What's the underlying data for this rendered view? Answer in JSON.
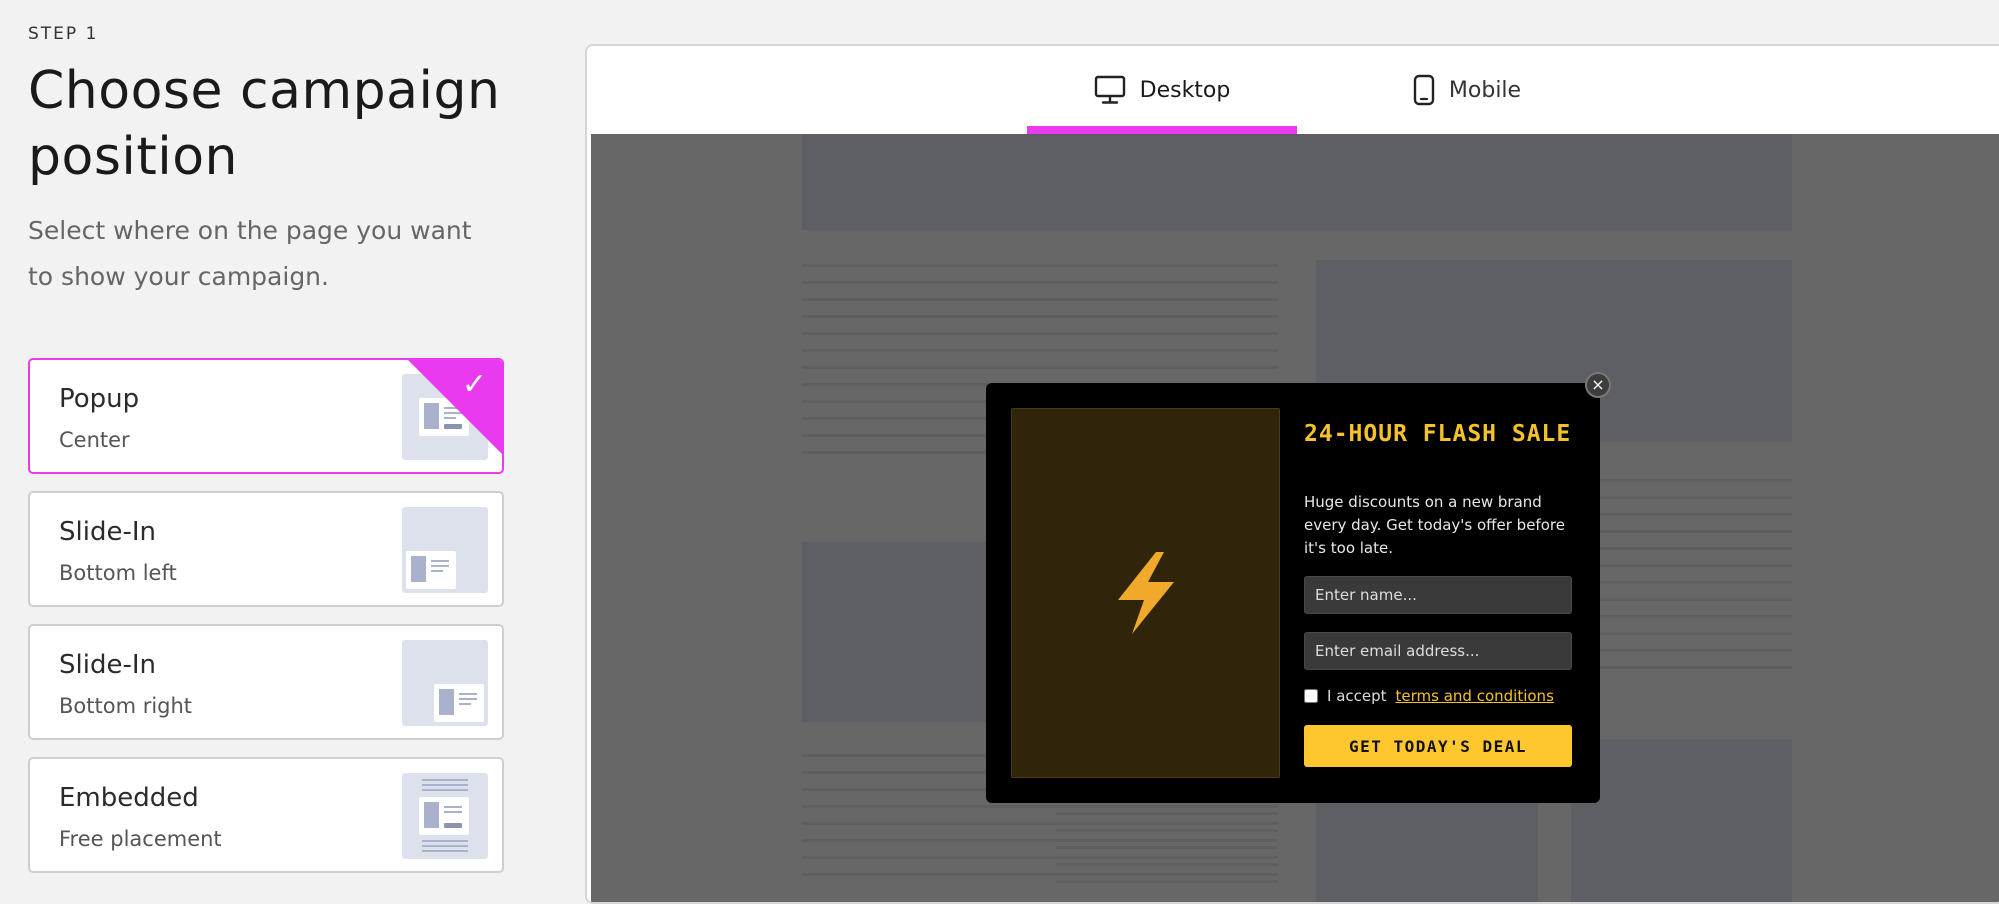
{
  "header": {
    "step": "STEP 1",
    "title": "Choose campaign position",
    "subtitle": "Select where on the page you want to show your campaign."
  },
  "positions": [
    {
      "name": "Popup",
      "sub": "Center",
      "selected": true,
      "icon": "popup-center-thumb"
    },
    {
      "name": "Slide-In",
      "sub": "Bottom left",
      "selected": false,
      "icon": "slidein-bottom-left-thumb"
    },
    {
      "name": "Slide-In",
      "sub": "Bottom right",
      "selected": false,
      "icon": "slidein-bottom-right-thumb"
    },
    {
      "name": "Embedded",
      "sub": "Free placement",
      "selected": false,
      "icon": "embedded-thumb"
    }
  ],
  "preview": {
    "tabs": [
      {
        "label": "Desktop",
        "icon": "desktop-monitor-icon",
        "active": true
      },
      {
        "label": "Mobile",
        "icon": "mobile-phone-icon",
        "active": false
      }
    ]
  },
  "popup": {
    "title": "24-HOUR FLASH SALE",
    "description": "Huge discounts on a new brand every day. Get today's offer before it's too late.",
    "name_placeholder": "Enter name...",
    "email_placeholder": "Enter email address...",
    "accept_text": "I accept",
    "terms_text": "terms and conditions",
    "cta": "GET TODAY'S DEAL",
    "close": "×"
  },
  "colors": {
    "accent": "#e93af0",
    "popup_title": "#f5c22a",
    "cta_bg": "#fec72d",
    "overlay": "#676767"
  }
}
